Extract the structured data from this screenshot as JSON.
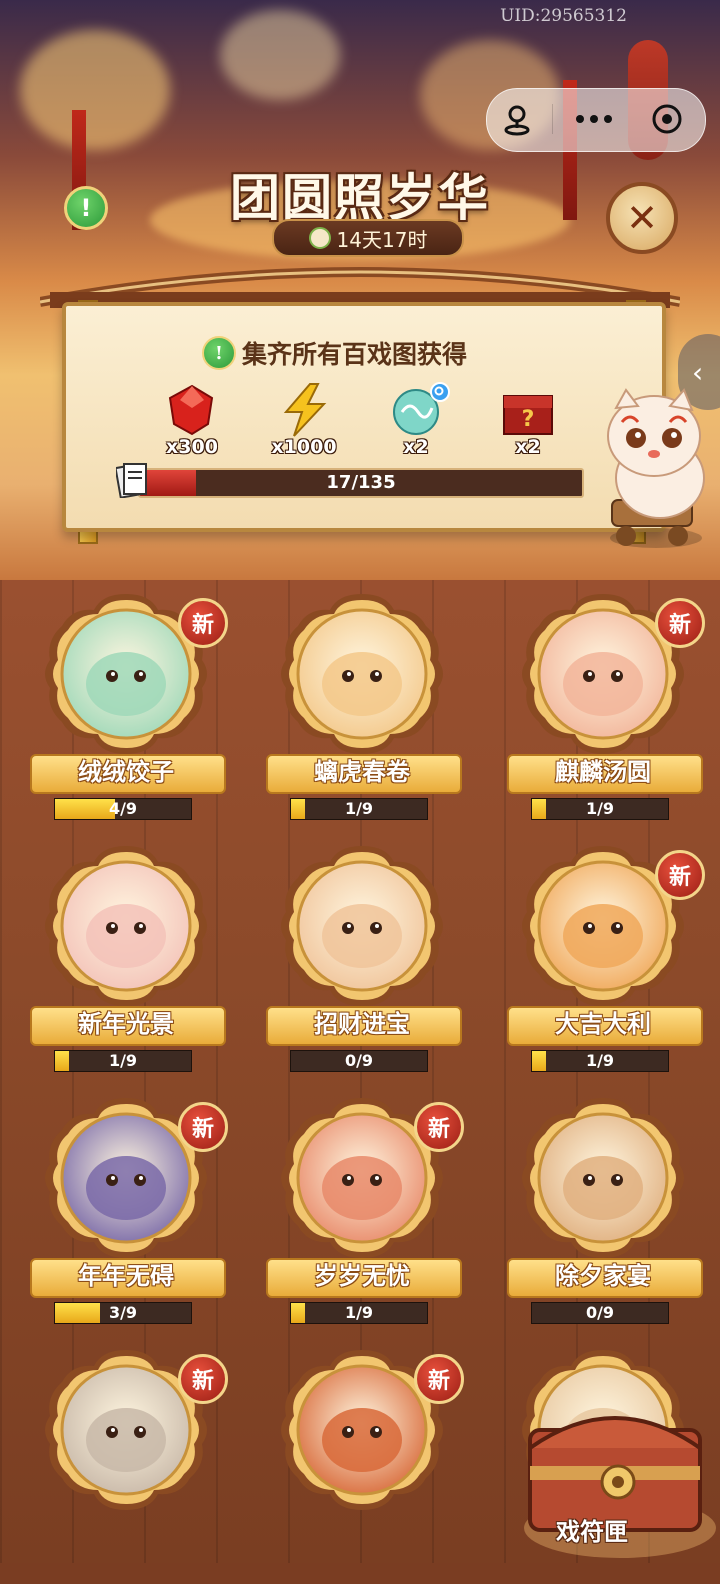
{
  "uid": "UID:29565312",
  "header": {
    "title": "团圆照岁华",
    "timer": "14天17时",
    "info_icon": "exclamation-icon",
    "close_icon": "close-icon"
  },
  "capsule": {
    "left_icon": "joystick-icon",
    "menu_icon": "more-dots-icon",
    "target_icon": "target-circle-icon"
  },
  "reward_panel": {
    "title": "集齐所有百戏图获得",
    "rewards": [
      {
        "icon": "red-gem-icon",
        "qty": "x300"
      },
      {
        "icon": "lightning-icon",
        "qty": "x1000"
      },
      {
        "icon": "jade-cloud-icon",
        "qty": "x2"
      },
      {
        "icon": "mystery-chest-icon",
        "qty": "x2"
      }
    ],
    "progress": {
      "text": "17/135",
      "value": 17,
      "max": 135
    }
  },
  "cards": [
    {
      "name": "绒绒饺子",
      "progress": "4/9",
      "value": 4,
      "new_badge": "新",
      "theme": "#9fd8b8"
    },
    {
      "name": "螭虎春卷",
      "progress": "1/9",
      "value": 1,
      "new_badge": "",
      "theme": "#f3c88a"
    },
    {
      "name": "麒麟汤圆",
      "progress": "1/9",
      "value": 1,
      "new_badge": "新",
      "theme": "#f2b59a"
    },
    {
      "name": "新年光景",
      "progress": "1/9",
      "value": 1,
      "new_badge": "",
      "theme": "#f3c2b8"
    },
    {
      "name": "招财进宝",
      "progress": "0/9",
      "value": 0,
      "new_badge": "",
      "theme": "#f0c49a"
    },
    {
      "name": "大吉大利",
      "progress": "1/9",
      "value": 1,
      "new_badge": "新",
      "theme": "#f0a85a"
    },
    {
      "name": "年年无碍",
      "progress": "3/9",
      "value": 3,
      "new_badge": "新",
      "theme": "#7a6aa8"
    },
    {
      "name": "岁岁无忧",
      "progress": "1/9",
      "value": 1,
      "new_badge": "新",
      "theme": "#e88a6a"
    },
    {
      "name": "除夕家宴",
      "progress": "0/9",
      "value": 0,
      "new_badge": "",
      "theme": "#e0b080"
    },
    {
      "name": "",
      "progress": "",
      "value": 0,
      "new_badge": "新",
      "theme": "#c8b8a8"
    },
    {
      "name": "",
      "progress": "",
      "value": 0,
      "new_badge": "新",
      "theme": "#d86a3a"
    },
    {
      "name": "",
      "progress": "",
      "value": 0,
      "new_badge": "",
      "theme": "#e8c8a0"
    }
  ],
  "card_max": 9,
  "chest_label": "戏符匣"
}
